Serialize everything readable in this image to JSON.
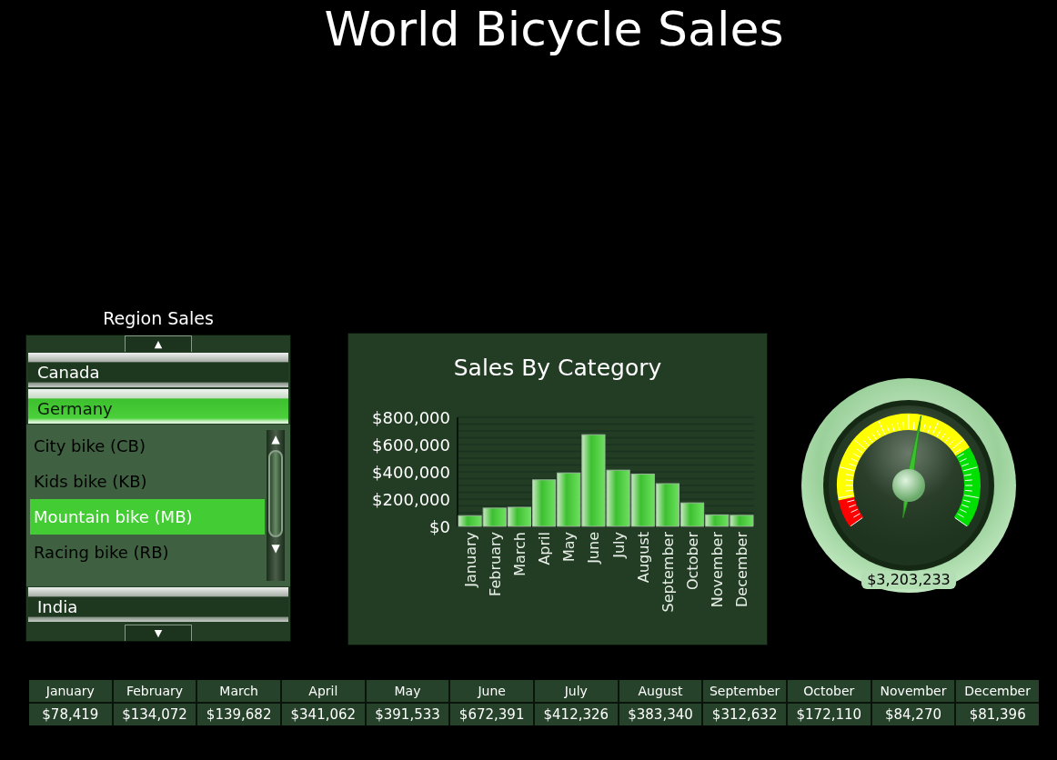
{
  "title": "World Bicycle Sales",
  "region_sales": {
    "title": "Region Sales",
    "scroll_up": "▲",
    "scroll_down": "▼",
    "list_scroll_up": "▲",
    "list_scroll_down": "▼",
    "regions": [
      {
        "name": "Canada",
        "selected": false
      },
      {
        "name": "Germany",
        "selected": true,
        "children": [
          {
            "label": "City bike (CB)",
            "selected": false
          },
          {
            "label": "Kids bike (KB)",
            "selected": false
          },
          {
            "label": "Mountain bike (MB)",
            "selected": true
          },
          {
            "label": "Racing bike (RB)",
            "selected": false
          }
        ]
      },
      {
        "name": "India",
        "selected": false
      }
    ]
  },
  "sales_chart": {
    "chart_data": {
      "type": "bar",
      "title": "Sales By Category",
      "categories": [
        "January",
        "February",
        "March",
        "April",
        "May",
        "June",
        "July",
        "August",
        "September",
        "October",
        "November",
        "December"
      ],
      "values": [
        78000,
        134000,
        140000,
        341000,
        392000,
        672000,
        412000,
        383000,
        313000,
        172000,
        84000,
        81000
      ],
      "grid": true,
      "ylim": [
        0,
        800000
      ],
      "yticks": [
        {
          "value": 0,
          "label": "$0"
        },
        {
          "value": 200000,
          "label": "$200,000"
        },
        {
          "value": 400000,
          "label": "$400,000"
        },
        {
          "value": 600000,
          "label": "$600,000"
        },
        {
          "value": 800000,
          "label": "$800,000"
        }
      ]
    }
  },
  "gauge": {
    "level": 0.54,
    "reading": "$3,203,233"
  },
  "table": {
    "columns": [
      "January",
      "February",
      "March",
      "April",
      "May",
      "June",
      "July",
      "August",
      "September",
      "October",
      "November",
      "December"
    ],
    "values": [
      "$78,419",
      "$134,072",
      "$139,682",
      "$341,062",
      "$391,533",
      "$672,391",
      "$412,326",
      "$383,340",
      "$312,632",
      "$172,110",
      "$84,270",
      "$81,396"
    ]
  }
}
